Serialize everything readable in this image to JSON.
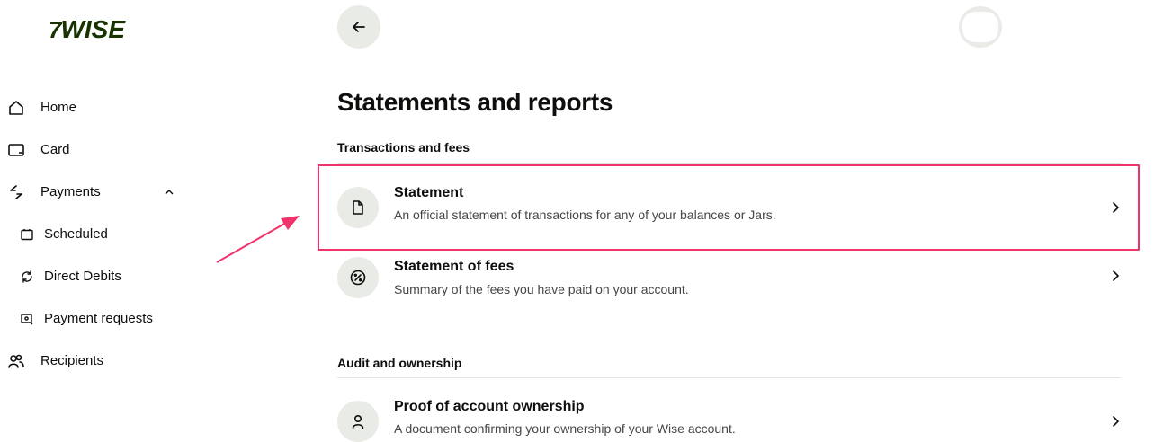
{
  "brand": {
    "logo_flag": "7",
    "logo_text": "WISE",
    "color": "#163300"
  },
  "accent_color": "#f0336b",
  "sidebar": {
    "items": [
      {
        "label": "Home",
        "icon": "home-icon",
        "level": "top"
      },
      {
        "label": "Card",
        "icon": "card-icon",
        "level": "top"
      },
      {
        "label": "Payments",
        "icon": "payments-icon",
        "level": "top",
        "expanded": true
      },
      {
        "label": "Scheduled",
        "icon": "calendar-icon",
        "level": "sub"
      },
      {
        "label": "Direct Debits",
        "icon": "refresh-icon",
        "level": "sub"
      },
      {
        "label": "Payment requests",
        "icon": "payment-request-icon",
        "level": "sub"
      },
      {
        "label": "Recipients",
        "icon": "recipients-icon",
        "level": "top"
      }
    ]
  },
  "header": {
    "back_icon": "arrow-left-icon"
  },
  "main": {
    "title": "Statements and reports",
    "sections": [
      {
        "title": "Transactions and fees",
        "rows": [
          {
            "title": "Statement",
            "description": "An official statement of transactions for any of your balances or Jars.",
            "icon": "document-icon"
          },
          {
            "title": "Statement of fees",
            "description": "Summary of the fees you have paid on your account.",
            "icon": "percent-icon"
          }
        ]
      },
      {
        "title": "Audit and ownership",
        "rows": [
          {
            "title": "Proof of account ownership",
            "description": "A document confirming your ownership of your Wise account.",
            "icon": "person-icon"
          }
        ]
      }
    ]
  }
}
